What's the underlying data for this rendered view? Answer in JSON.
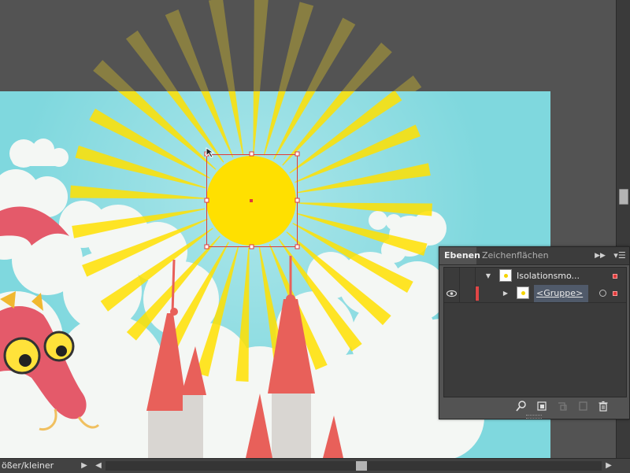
{
  "status_bar": {
    "zoom_hint": "ößer/kleiner"
  },
  "layers_panel": {
    "tabs": [
      "Ebenen",
      "Zeichenflächen"
    ],
    "rows": [
      {
        "name": "Isolationsmo...",
        "expanded": true
      },
      {
        "name": "<Gruppe>",
        "expanded": false,
        "visible": true
      }
    ]
  },
  "colors": {
    "sky": "#7fd8de",
    "sun": "#ffe000",
    "selection": "#e03a3a",
    "layer_color": "#e04646",
    "roof": "#e8605a",
    "tower": "#d9d6d2",
    "dragon": "#e45a6a"
  }
}
